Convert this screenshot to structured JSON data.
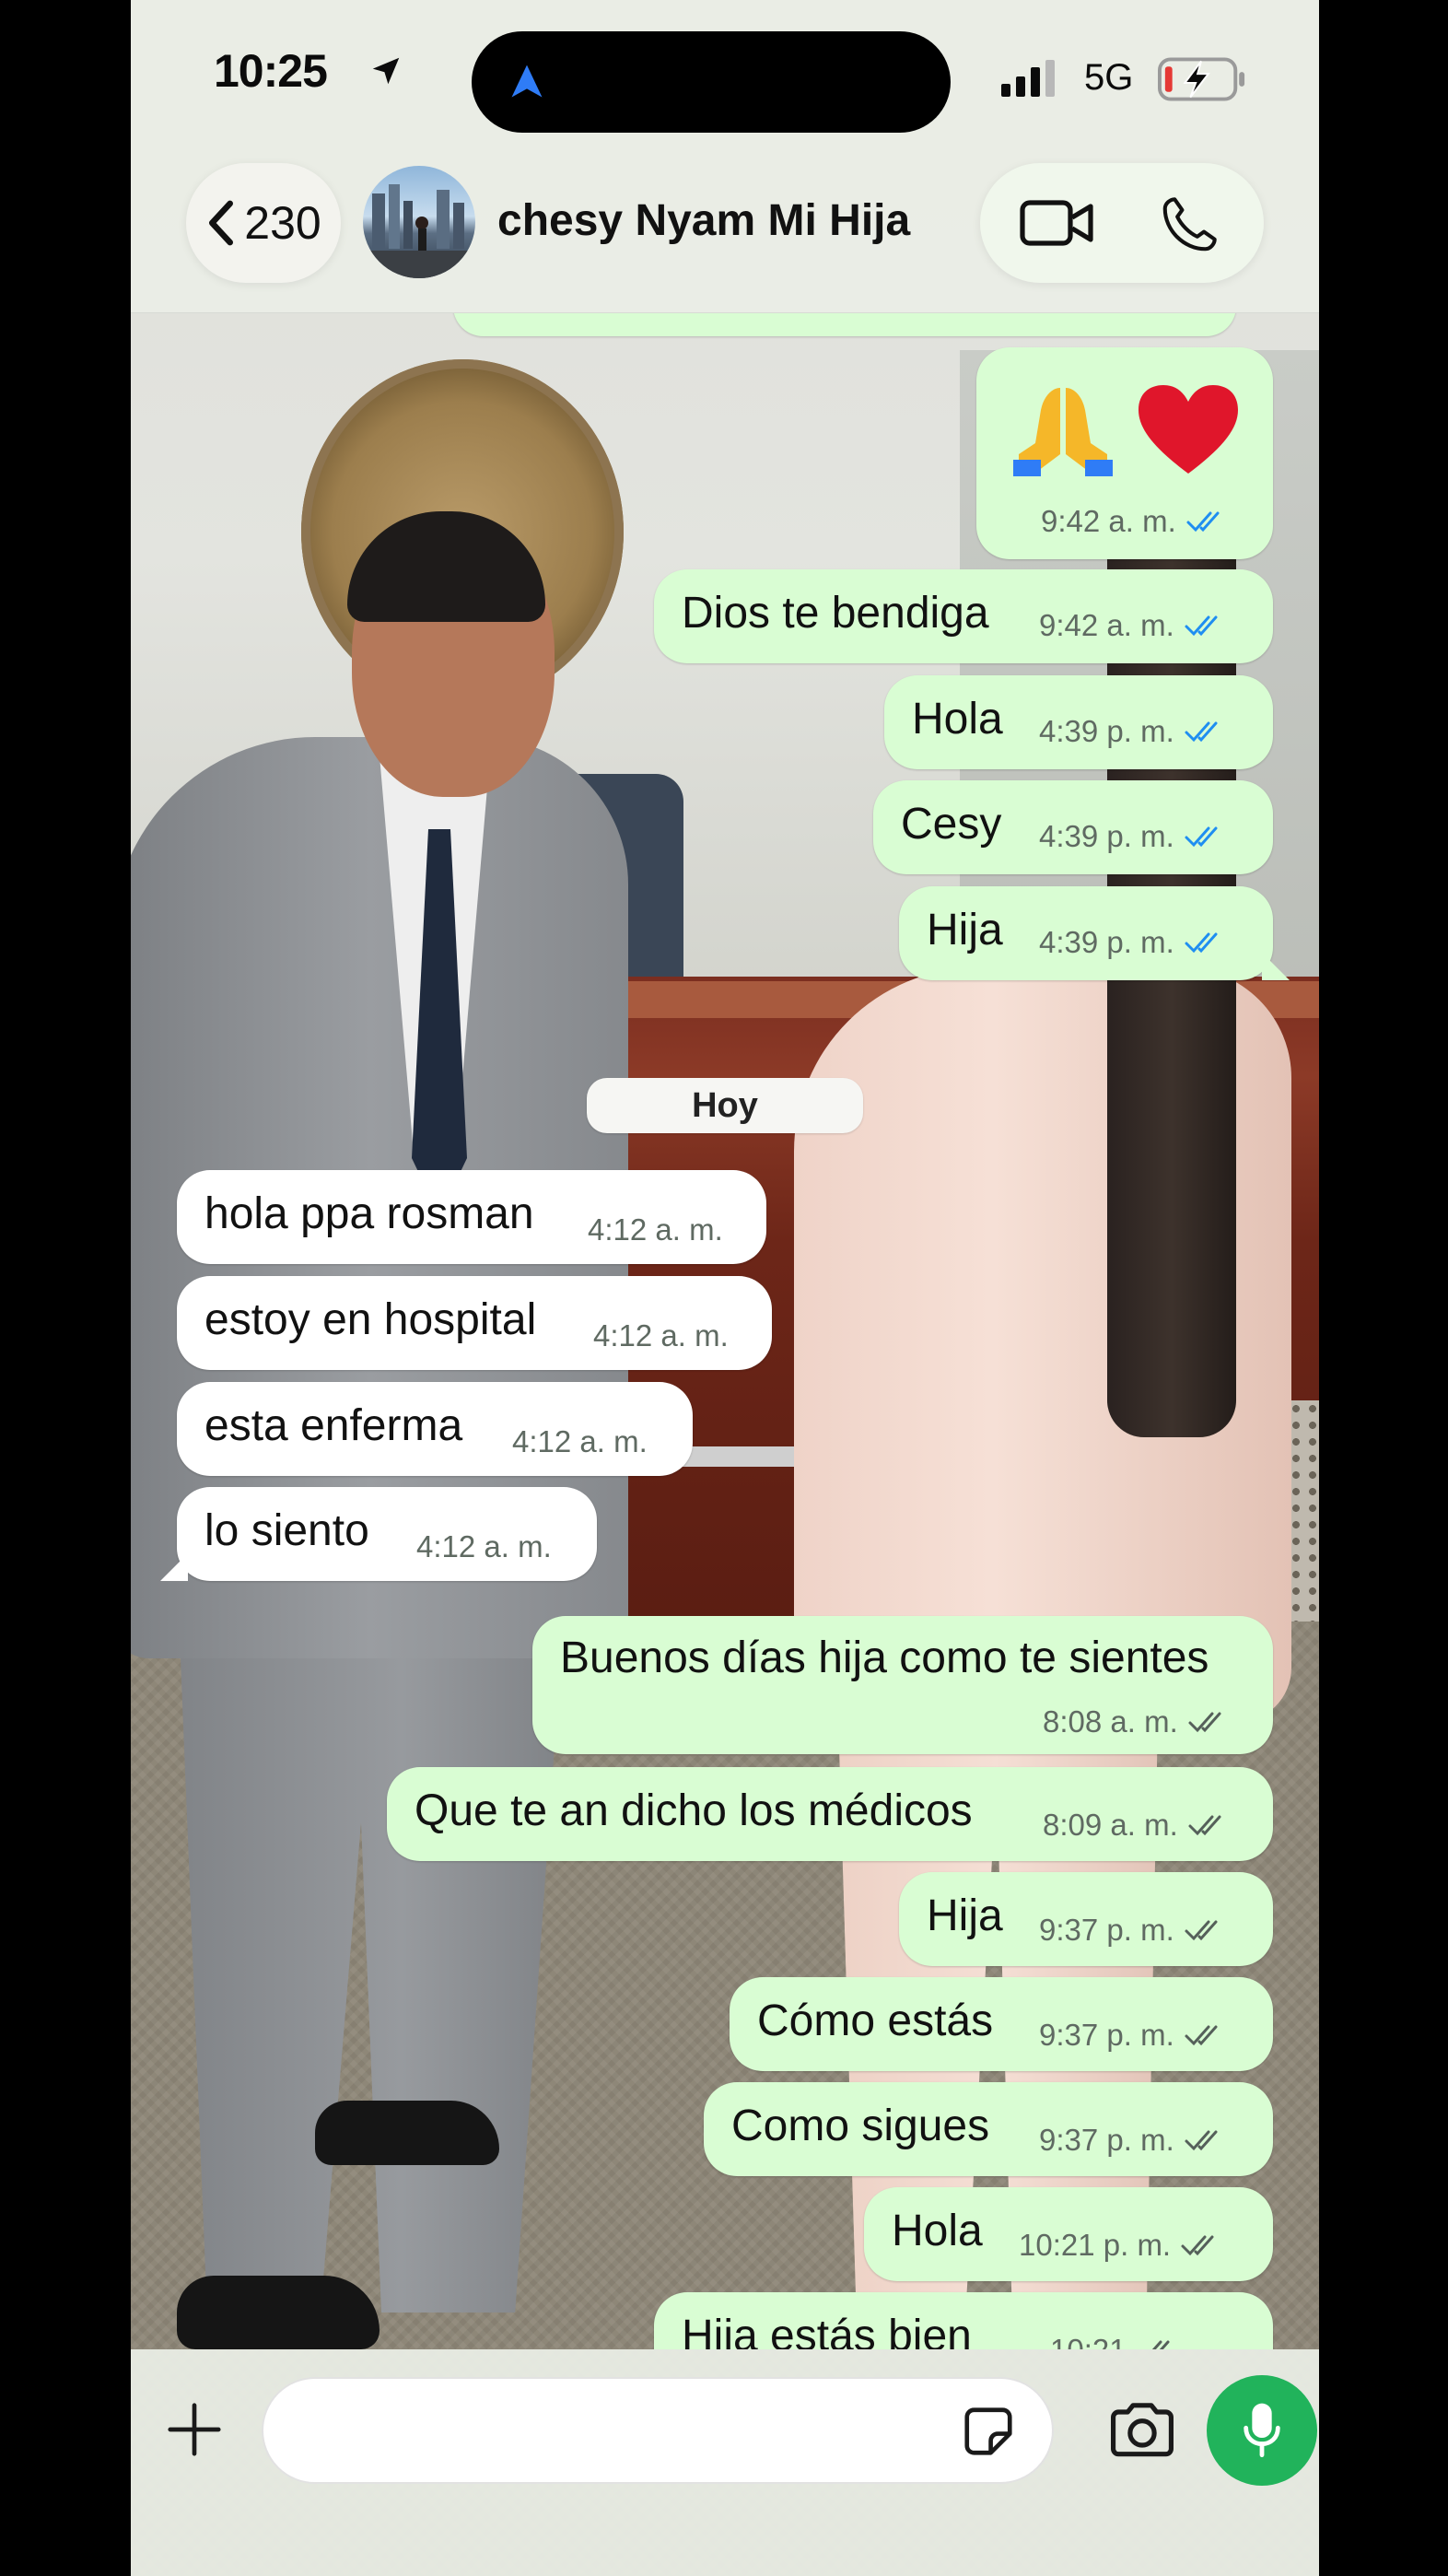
{
  "status_bar": {
    "time": "10:25",
    "network": "5G",
    "location_icon": "location-arrow-icon",
    "signal_icon": "cellular-signal-icon",
    "battery_icon": "battery-charging-icon",
    "island_icon": "navigation-arrow-icon"
  },
  "header": {
    "back_count": "230",
    "contact_name": "chesy Nyam Mi Hija",
    "video_icon": "video-camera-icon",
    "call_icon": "phone-icon"
  },
  "messages": [
    {
      "dir": "out",
      "text": "🙏❤️",
      "time": "9:42 a. m.",
      "status": "read"
    },
    {
      "dir": "out",
      "text": "Dios te bendiga",
      "time": "9:42 a. m.",
      "status": "read"
    },
    {
      "dir": "out",
      "text": "Hola",
      "time": "4:39 p. m.",
      "status": "read"
    },
    {
      "dir": "out",
      "text": "Cesy",
      "time": "4:39 p. m.",
      "status": "read"
    },
    {
      "dir": "out",
      "text": "Hija",
      "time": "4:39 p. m.",
      "status": "read"
    },
    {
      "dir": "in",
      "text": "hola ppa rosman",
      "time": "4:12 a. m."
    },
    {
      "dir": "in",
      "text": "estoy en hospital",
      "time": "4:12 a. m."
    },
    {
      "dir": "in",
      "text": "esta enferma",
      "time": "4:12 a. m."
    },
    {
      "dir": "in",
      "text": "lo siento",
      "time": "4:12 a. m."
    },
    {
      "dir": "out",
      "text": "Buenos días hija como te sientes",
      "time": "8:08 a. m.",
      "status": "delivered"
    },
    {
      "dir": "out",
      "text": "Que te an dicho los médicos",
      "time": "8:09 a. m.",
      "status": "delivered"
    },
    {
      "dir": "out",
      "text": "Hija",
      "time": "9:37 p. m.",
      "status": "delivered"
    },
    {
      "dir": "out",
      "text": "Cómo estás",
      "time": "9:37 p. m.",
      "status": "delivered"
    },
    {
      "dir": "out",
      "text": "Como sigues",
      "time": "9:37 p. m.",
      "status": "delivered"
    },
    {
      "dir": "out",
      "text": "Hola",
      "time": "10:21 p. m.",
      "status": "delivered"
    },
    {
      "dir": "out",
      "text": "Hija estás bien",
      "time": "10:21",
      "status": "delivered"
    }
  ],
  "day_separator": "Hoy",
  "composer": {
    "placeholder": "",
    "attach_icon": "plus-icon",
    "sticker_icon": "sticker-icon",
    "camera_icon": "camera-icon",
    "mic_icon": "microphone-icon"
  },
  "colors": {
    "outgoing_bubble": "#d9fdd3",
    "incoming_bubble": "#ffffff",
    "read_ticks": "#1f8ef1",
    "delivered_ticks": "#55605a",
    "mic_button": "#21b35b"
  }
}
